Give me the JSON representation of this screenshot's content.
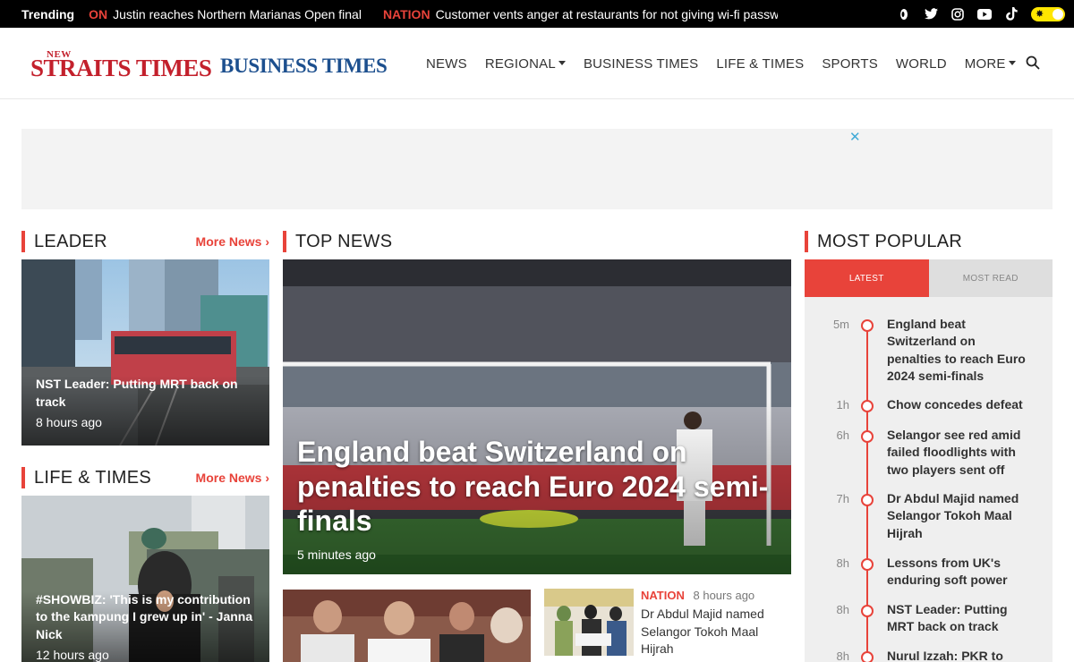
{
  "trending": {
    "label": "Trending",
    "items": [
      {
        "category": "ON",
        "text": "Justin reaches Northern Marianas Open final"
      },
      {
        "category": "NATION",
        "text": "Customer vents anger at restaurants for not giving wi-fi passw"
      }
    ]
  },
  "social": [
    "tiktok-alt-icon",
    "twitter-icon",
    "instagram-icon",
    "youtube-icon",
    "tiktok-icon"
  ],
  "logos": {
    "nst_new": "NEW",
    "nst_main": "STRAITS TIMES",
    "bt": "BUSINESS TIMES"
  },
  "nav": [
    {
      "label": "NEWS",
      "dropdown": false
    },
    {
      "label": "REGIONAL",
      "dropdown": true
    },
    {
      "label": "BUSINESS TIMES",
      "dropdown": false
    },
    {
      "label": "LIFE & TIMES",
      "dropdown": false
    },
    {
      "label": "SPORTS",
      "dropdown": false
    },
    {
      "label": "WORLD",
      "dropdown": false
    },
    {
      "label": "MORE",
      "dropdown": true
    }
  ],
  "ad": {
    "close": "✕"
  },
  "leader": {
    "title": "LEADER",
    "more": "More News ›",
    "card": {
      "title": "NST Leader: Putting MRT back on track",
      "time": "8 hours ago"
    }
  },
  "life": {
    "title": "LIFE & TIMES",
    "more": "More News ›",
    "card": {
      "title": "#SHOWBIZ: 'This is my contribution to the kampung I grew up in' - Janna Nick",
      "time": "12 hours ago"
    }
  },
  "top": {
    "title": "TOP NEWS",
    "hero": {
      "title": "England beat Switzerland on penalties to reach Euro 2024 semi-finals",
      "time": "5 minutes ago"
    },
    "sub2": {
      "category": "NATION",
      "time": "8 hours ago",
      "title": "Dr Abdul Majid named Selangor Tokoh Maal Hijrah"
    }
  },
  "popular": {
    "title": "MOST POPULAR",
    "tabs": {
      "latest": "LATEST",
      "most_read": "MOST READ"
    },
    "items": [
      {
        "time": "5m",
        "title": "England beat Switzerland on penalties to reach Euro 2024 semi-finals"
      },
      {
        "time": "1h",
        "title": "Chow concedes defeat"
      },
      {
        "time": "6h",
        "title": "Selangor see red amid failed floodlights with two players sent off"
      },
      {
        "time": "7h",
        "title": "Dr Abdul Majid named Selangor Tokoh Maal Hijrah"
      },
      {
        "time": "8h",
        "title": "Lessons from UK's enduring soft power"
      },
      {
        "time": "8h",
        "title": "NST Leader: Putting MRT back on track"
      },
      {
        "time": "8h",
        "title": "Nurul Izzah: PKR to"
      }
    ]
  },
  "colors": {
    "accent": "#e8433a",
    "nst_red": "#c3202c",
    "bt_blue": "#1c4f8e",
    "toggle": "#ffe600"
  }
}
